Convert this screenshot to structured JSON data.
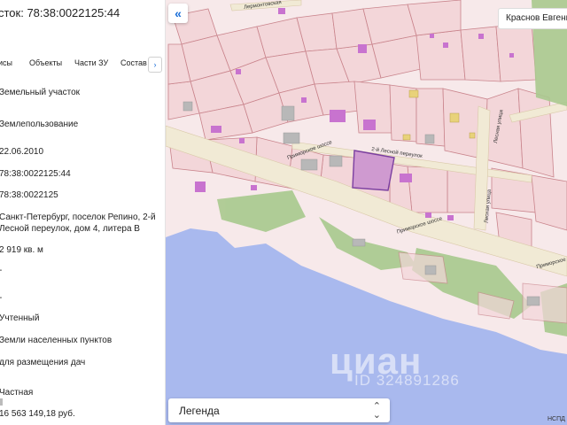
{
  "title": "сток: 78:38:0022125:44",
  "tabs": [
    "исы",
    "Объекты",
    "Части ЗУ",
    "Состав"
  ],
  "tab_next_icon": "chevron-right-icon",
  "fields": [
    {
      "key": "type",
      "value": "Земельный участок"
    },
    {
      "key": "kind",
      "value": "Землепользование"
    },
    {
      "key": "date",
      "value": "22.06.2010"
    },
    {
      "key": "cad_number",
      "value": "78:38:0022125:44"
    },
    {
      "key": "quarter",
      "value": "78:38:0022125"
    },
    {
      "key": "address",
      "value": "Санкт-Петербург, поселок Репино, 2-й Лесной переулок, дом 4, литера В"
    },
    {
      "key": "area",
      "value": "2 919 кв. м"
    },
    {
      "key": "dash1",
      "value": "-"
    },
    {
      "key": "dash2",
      "value": "-"
    },
    {
      "key": "status",
      "value": "Учтенный"
    },
    {
      "key": "category",
      "value": "Земли населенных пунктов"
    },
    {
      "key": "use",
      "value": "для размещения дач"
    },
    {
      "key": "ownership",
      "value": "Частная"
    },
    {
      "key": "cost",
      "value": "16 563 149,18 руб."
    }
  ],
  "map": {
    "collapse_icon": "double-chevron-left-icon",
    "user_name": "Краснов Евгени",
    "legend_label": "Легенда",
    "legend_icon": "up-down-chevron-icon",
    "attribution": "НСПД",
    "street_labels": [
      "Приморское шоссе",
      "Приморское шоссе",
      "Приморское ш",
      "2-й Лесной переулок",
      "Лесная улица",
      "Лесная улица",
      "Лермонтовская"
    ],
    "watermark_brand": "циан",
    "watermark_id": "ID 324891286",
    "colors": {
      "parcel_fill": "#f3d6d9",
      "parcel_stroke": "#c9848c",
      "road": "#f1ead5",
      "water": "#a9b9ee",
      "greenery": "#a8c98e",
      "building": "#c873cf",
      "selected_parcel": "#cf9ad0",
      "accent": "#1a6ed8"
    }
  }
}
